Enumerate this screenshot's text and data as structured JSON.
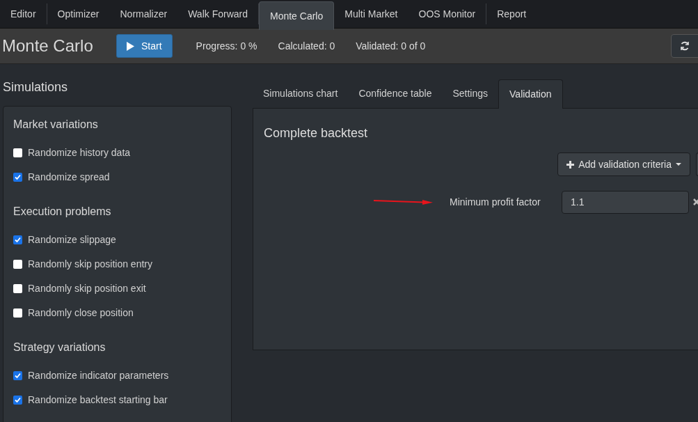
{
  "nav_groups": [
    [
      {
        "label": "Editor",
        "selected": false
      }
    ],
    [
      {
        "label": "Optimizer",
        "selected": false
      },
      {
        "label": "Normalizer",
        "selected": false
      },
      {
        "label": "Walk Forward",
        "selected": false
      }
    ],
    [
      {
        "label": "Monte Carlo",
        "selected": true
      },
      {
        "label": "Multi Market",
        "selected": false
      },
      {
        "label": "OOS Monitor",
        "selected": false
      }
    ],
    [
      {
        "label": "Report",
        "selected": false
      }
    ]
  ],
  "toolbar": {
    "title": "Monte Carlo",
    "start_button": "Start",
    "progress": "Progress: 0 %",
    "calculated": "Calculated: 0",
    "validated": "Validated: 0 of 0"
  },
  "simulations": {
    "title": "Simulations",
    "sections": [
      {
        "title": "Market variations",
        "options": [
          {
            "label": "Randomize history data",
            "checked": false
          },
          {
            "label": "Randomize spread",
            "checked": true
          }
        ]
      },
      {
        "title": "Execution problems",
        "options": [
          {
            "label": "Randomize slippage",
            "checked": true
          },
          {
            "label": "Randomly skip position entry",
            "checked": false
          },
          {
            "label": "Randomly skip position exit",
            "checked": false
          },
          {
            "label": "Randomly close position",
            "checked": false
          }
        ]
      },
      {
        "title": "Strategy variations",
        "options": [
          {
            "label": "Randomize indicator parameters",
            "checked": true
          },
          {
            "label": "Randomize backtest starting bar",
            "checked": true
          }
        ]
      }
    ]
  },
  "content_tabs": [
    {
      "label": "Simulations chart",
      "selected": false
    },
    {
      "label": "Confidence table",
      "selected": false
    },
    {
      "label": "Settings",
      "selected": false
    },
    {
      "label": "Validation",
      "selected": true
    }
  ],
  "validation": {
    "title": "Complete backtest",
    "add_button": "Add validation criteria",
    "criteria": [
      {
        "label": "Minimum profit factor",
        "value": "1.1"
      }
    ]
  }
}
